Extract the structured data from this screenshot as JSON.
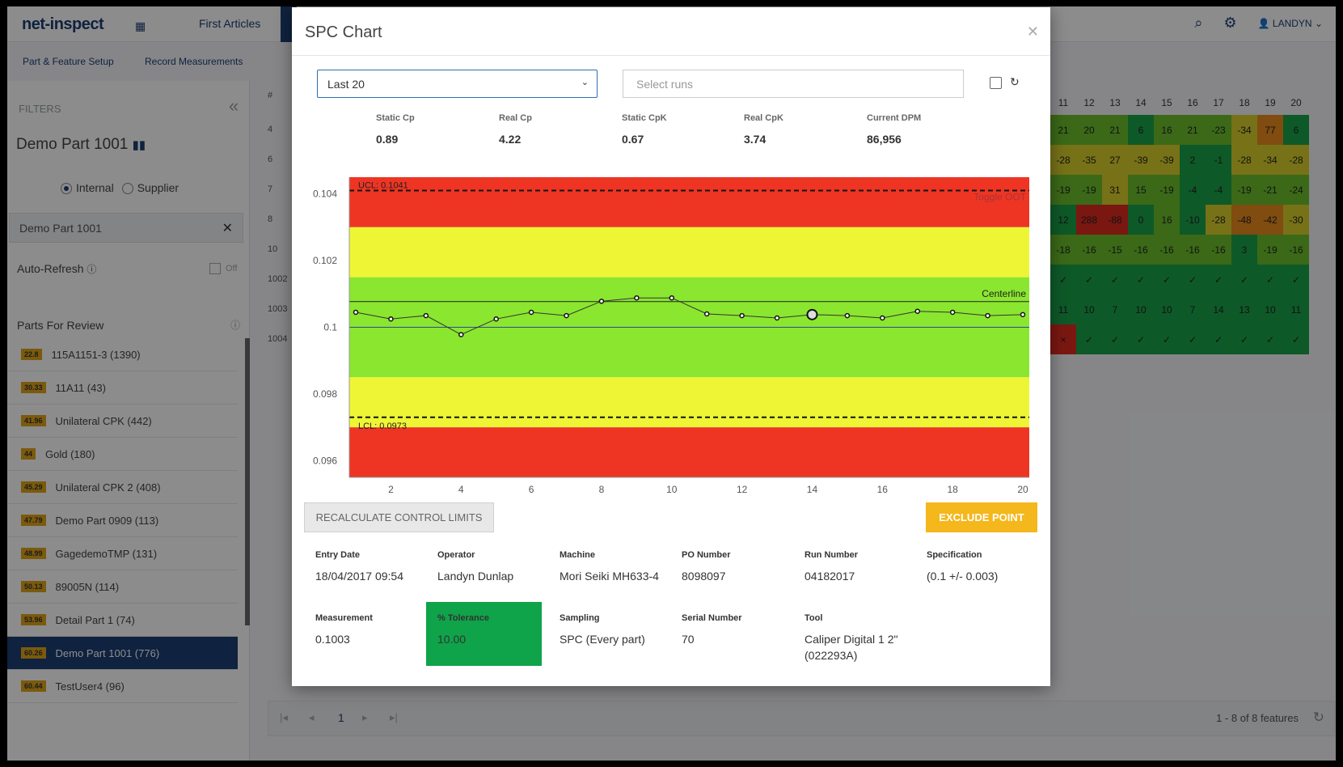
{
  "app": {
    "logo": "net-inspect",
    "nav": {
      "first_articles": "First Articles"
    },
    "user": "LANDYN",
    "subnav": {
      "part_feature_setup": "Part & Feature Setup",
      "record_measurements": "Record Measurements"
    }
  },
  "sidebar": {
    "filters_label": "FILTERS",
    "part_title": "Demo Part 1001",
    "radio_internal": "Internal",
    "radio_supplier": "Supplier",
    "search_value": "Demo Part 1001",
    "auto_refresh_label": "Auto-Refresh",
    "auto_refresh_state": "Off",
    "parts_for_review_label": "Parts For Review",
    "parts": [
      {
        "score": "22.8",
        "name": "115A1151-3 (1390)"
      },
      {
        "score": "30.33",
        "name": "11A11 (43)"
      },
      {
        "score": "41.96",
        "name": "Unilateral CPK (442)"
      },
      {
        "score": "44",
        "name": "Gold (180)"
      },
      {
        "score": "45.29",
        "name": "Unilateral CPK 2 (408)"
      },
      {
        "score": "47.79",
        "name": "Demo Part 0909 (113)"
      },
      {
        "score": "48.99",
        "name": "GagedemoTMP (131)"
      },
      {
        "score": "50.13",
        "name": "89005N (114)"
      },
      {
        "score": "53.96",
        "name": "Detail Part 1 (74)"
      },
      {
        "score": "60.26",
        "name": "Demo Part 1001 (776)"
      },
      {
        "score": "60.44",
        "name": "TestUser4 (96)"
      }
    ],
    "active_index": 9
  },
  "background_table": {
    "row_labels": [
      "4",
      "6",
      "7",
      "8",
      "10",
      "1002",
      "1003",
      "1004"
    ],
    "col_headers": [
      "11",
      "12",
      "13",
      "14",
      "15",
      "16",
      "17",
      "18",
      "19",
      "20"
    ],
    "cells": [
      [
        "21",
        "20",
        "21",
        "6",
        "16",
        "21",
        "-23",
        "-34",
        "77",
        "6"
      ],
      [
        "-28",
        "-35",
        "27",
        "-39",
        "-39",
        "2",
        "-1",
        "-28",
        "-34",
        "-28"
      ],
      [
        "-19",
        "-19",
        "31",
        "15",
        "-19",
        "-4",
        "-4",
        "-19",
        "-21",
        "-24"
      ],
      [
        "12",
        "288",
        "-88",
        "0",
        "16",
        "-10",
        "-28",
        "-48",
        "-42",
        "-30"
      ],
      [
        "-18",
        "-16",
        "-15",
        "-16",
        "-16",
        "-16",
        "-16",
        "3",
        "-19",
        "-16"
      ],
      [
        "✓",
        "✓",
        "✓",
        "✓",
        "✓",
        "✓",
        "✓",
        "✓",
        "✓",
        "✓"
      ],
      [
        "11",
        "10",
        "7",
        "10",
        "10",
        "7",
        "14",
        "13",
        "10",
        "11"
      ],
      [
        "×",
        "✓",
        "✓",
        "✓",
        "✓",
        "✓",
        "✓",
        "✓",
        "✓",
        "✓"
      ]
    ],
    "pager_page": "1",
    "pager_info": "1 - 8 of 8 features"
  },
  "modal": {
    "title": "SPC Chart",
    "range_select": "Last 20",
    "runs_placeholder": "Select runs",
    "stats": [
      {
        "label": "Static Cp",
        "value": "0.89"
      },
      {
        "label": "Real Cp",
        "value": "4.22"
      },
      {
        "label": "Static CpK",
        "value": "0.67"
      },
      {
        "label": "Real CpK",
        "value": "3.74"
      },
      {
        "label": "Current DPM",
        "value": "86,956"
      }
    ],
    "recalc_button": "RECALCULATE CONTROL LIMITS",
    "exclude_button": "EXCLUDE POINT",
    "details": {
      "entry_date_label": "Entry Date",
      "entry_date": "18/04/2017 09:54",
      "operator_label": "Operator",
      "operator": "Landyn Dunlap",
      "machine_label": "Machine",
      "machine": "Mori Seiki MH633-4",
      "po_label": "PO Number",
      "po": "8098097",
      "run_label": "Run Number",
      "run": "04182017",
      "spec_label": "Specification",
      "spec": "(0.1 +/- 0.003)",
      "measurement_label": "Measurement",
      "measurement": "0.1003",
      "tolerance_label": "% Tolerance",
      "tolerance": "10.00",
      "sampling_label": "Sampling",
      "sampling": "SPC (Every part)",
      "serial_label": "Serial Number",
      "serial": "70",
      "tool_label": "Tool",
      "tool": "Caliper Digital 1 2\" (022293A)"
    }
  },
  "chart_data": {
    "type": "line",
    "x": [
      1,
      2,
      3,
      4,
      5,
      6,
      7,
      8,
      9,
      10,
      11,
      12,
      13,
      14,
      15,
      16,
      17,
      18,
      19,
      20
    ],
    "values": [
      0.10045,
      0.10025,
      0.10035,
      0.09978,
      0.10025,
      0.10045,
      0.10035,
      0.10078,
      0.10088,
      0.10088,
      0.1004,
      0.10035,
      0.10028,
      0.10038,
      0.10035,
      0.10028,
      0.10048,
      0.10045,
      0.10035,
      0.10038
    ],
    "selected_point": 14,
    "ylim": [
      0.0955,
      0.1045
    ],
    "xlim": [
      1,
      20
    ],
    "yticks": [
      0.096,
      0.098,
      0.1,
      0.102,
      0.104
    ],
    "xticks": [
      2,
      4,
      6,
      8,
      10,
      12,
      14,
      16,
      18,
      20
    ],
    "ucl": 0.1041,
    "lcl": 0.0973,
    "ucl_label": "UCL: 0.1041",
    "lcl_label": "LCL: 0.0973",
    "centerline": 0.10077,
    "centerline_label": "Centerline",
    "nominal": 0.1,
    "toggle_label": "Toggle OOT",
    "bands": [
      {
        "from": 0.103,
        "to": 0.1045,
        "color": "#ee3524"
      },
      {
        "from": 0.1015,
        "to": 0.103,
        "color": "#eef534"
      },
      {
        "from": 0.0985,
        "to": 0.1015,
        "color": "#8ae62f"
      },
      {
        "from": 0.097,
        "to": 0.0985,
        "color": "#eef534"
      },
      {
        "from": 0.0955,
        "to": 0.097,
        "color": "#ee3524"
      }
    ]
  }
}
